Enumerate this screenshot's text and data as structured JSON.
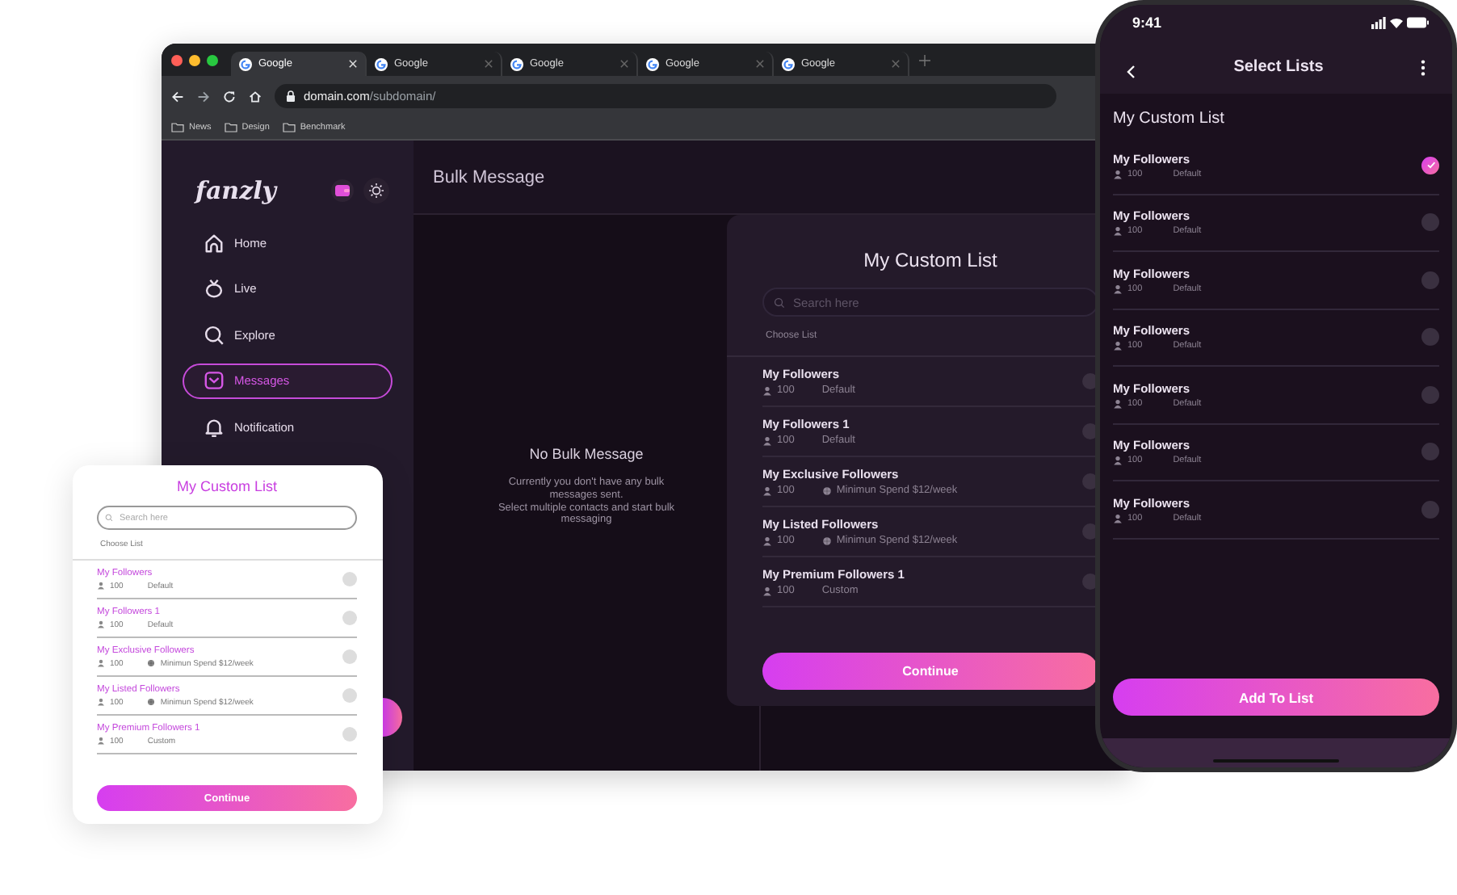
{
  "browser": {
    "tabs": [
      {
        "label": "Google",
        "selected": true
      },
      {
        "label": "Google",
        "selected": false
      },
      {
        "label": "Google",
        "selected": false
      },
      {
        "label": "Google",
        "selected": false
      },
      {
        "label": "Google",
        "selected": false
      }
    ],
    "address": {
      "host": "domain.com",
      "path": "/subdomain/"
    },
    "bookmarks": [
      "News",
      "Design",
      "Benchmark"
    ]
  },
  "sidebar": {
    "logo": "fanzly",
    "items": [
      {
        "kind": "home",
        "label": "Home",
        "selected": false
      },
      {
        "kind": "live",
        "label": "Live",
        "selected": false
      },
      {
        "kind": "explore",
        "label": "Explore",
        "selected": false
      },
      {
        "kind": "messages",
        "label": "Messages",
        "selected": true
      },
      {
        "kind": "notification",
        "label": "Notification",
        "selected": false
      }
    ]
  },
  "main": {
    "title": "Bulk Message",
    "empty_state": {
      "title": "No Bulk Message",
      "text": "Currently you don't have any bulk messages sent.",
      "hint": "Select multiple contacts and start bulk messaging"
    }
  },
  "modal": {
    "title": "My Custom List",
    "search": {
      "placeholder": "Search here"
    },
    "subtitle": "Choose List",
    "lists": [
      {
        "name": "My Followers",
        "count": "100",
        "kind": "default",
        "info": "Default",
        "checked": false
      },
      {
        "name": "My Followers 1",
        "count": "100",
        "kind": "default",
        "info": "Default",
        "checked": false
      },
      {
        "name": "My Exclusive Followers",
        "count": "100",
        "kind": "spend",
        "info": "Minimun Spend $12/week",
        "checked": false
      },
      {
        "name": "My Listed Followers",
        "count": "100",
        "kind": "spend",
        "info": "Minimun Spend $12/week",
        "checked": false
      },
      {
        "name": "My Premium Followers 1",
        "count": "100",
        "kind": "default",
        "info": "Custom",
        "checked": false
      }
    ],
    "button": "Continue"
  },
  "card": {
    "title": "My Custom List",
    "search": {
      "placeholder": "Search here"
    },
    "subtitle": "Choose List",
    "lists": [
      {
        "name": "My Followers",
        "count": "100",
        "kind": "default",
        "info": "Default",
        "checked": false
      },
      {
        "name": "My Followers 1",
        "count": "100",
        "kind": "default",
        "info": "Default",
        "checked": false
      },
      {
        "name": "My Exclusive Followers",
        "count": "100",
        "kind": "spend",
        "info": "Minimun Spend $12/week",
        "checked": false
      },
      {
        "name": "My Listed Followers",
        "count": "100",
        "kind": "spend",
        "info": "Minimun Spend $12/week",
        "checked": false
      },
      {
        "name": "My Premium Followers 1",
        "count": "100",
        "kind": "default",
        "info": "Custom",
        "checked": false
      }
    ],
    "button": "Continue"
  },
  "phone": {
    "time": "9:41",
    "title": "Select Lists",
    "section": "My Custom List",
    "lists": [
      {
        "name": "My Followers",
        "count": "100",
        "info": "Default",
        "checked": true
      },
      {
        "name": "My Followers",
        "count": "100",
        "info": "Default",
        "checked": false
      },
      {
        "name": "My Followers",
        "count": "100",
        "info": "Default",
        "checked": false
      },
      {
        "name": "My Followers",
        "count": "100",
        "info": "Default",
        "checked": false
      },
      {
        "name": "My Followers",
        "count": "100",
        "info": "Default",
        "checked": false
      },
      {
        "name": "My Followers",
        "count": "100",
        "info": "Default",
        "checked": false
      },
      {
        "name": "My Followers",
        "count": "100",
        "info": "Default",
        "checked": false
      }
    ],
    "button": "Add To List"
  }
}
